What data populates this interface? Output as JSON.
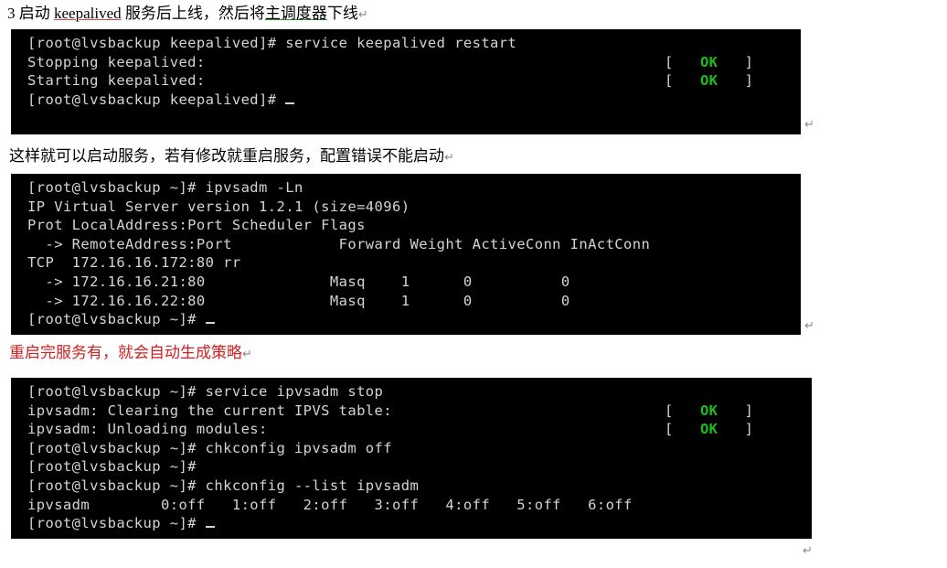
{
  "document": {
    "paragraph_1": {
      "number": "3",
      "text_before": " 启动 ",
      "spell_word": "keepalived",
      "text_mid": " 服务后上线，然后将",
      "grammar_word": "主调度器",
      "text_after": "下线",
      "pilcrow": "↵"
    },
    "paragraph_2": {
      "text": "这样就可以启动服务，若有修改就重启服务，配置错误不能启动",
      "pilcrow": "↵"
    },
    "paragraph_3": {
      "text": "重启完服务有，就会自动生成策略",
      "pilcrow": "↵",
      "color": "#d02020"
    }
  },
  "terminals": [
    {
      "name": "keepalived-restart-terminal",
      "pilcrow": "↵",
      "lines": [
        {
          "text": "[root@lvsbackup keepalived]# service keepalived restart",
          "status": null
        },
        {
          "text": "Stopping keepalived:",
          "status": {
            "open": "[",
            "label": "OK",
            "close": "]"
          }
        },
        {
          "text": "Starting keepalived:",
          "status": {
            "open": "[",
            "label": "OK",
            "close": "]"
          }
        },
        {
          "text": "[root@lvsbackup keepalived]# ",
          "status": null,
          "cursor": true
        }
      ]
    },
    {
      "name": "ipvsadm-list-terminal",
      "pilcrow": "↵",
      "lines": [
        {
          "text": "[root@lvsbackup ~]# ipvsadm -Ln",
          "status": null
        },
        {
          "text": "IP Virtual Server version 1.2.1 (size=4096)",
          "status": null
        },
        {
          "text": "Prot LocalAddress:Port Scheduler Flags",
          "status": null
        },
        {
          "text": "  -> RemoteAddress:Port            Forward Weight ActiveConn InActConn",
          "status": null
        },
        {
          "text": "TCP  172.16.16.172:80 rr",
          "status": null
        },
        {
          "text": "  -> 172.16.16.21:80              Masq    1      0          0",
          "status": null
        },
        {
          "text": "  -> 172.16.16.22:80              Masq    1      0          0",
          "status": null
        },
        {
          "text": "[root@lvsbackup ~]# ",
          "status": null,
          "cursor": true
        }
      ]
    },
    {
      "name": "ipvsadm-stop-chkconfig-terminal",
      "pilcrow": "↵",
      "lines": [
        {
          "text": "[root@lvsbackup ~]# service ipvsadm stop",
          "status": null
        },
        {
          "text": "ipvsadm: Clearing the current IPVS table:",
          "status": {
            "open": "[",
            "label": "OK",
            "close": "]"
          }
        },
        {
          "text": "ipvsadm: Unloading modules:",
          "status": {
            "open": "[",
            "label": "OK",
            "close": "]"
          }
        },
        {
          "text": "[root@lvsbackup ~]# chkconfig ipvsadm off",
          "status": null
        },
        {
          "text": "[root@lvsbackup ~]#",
          "status": null
        },
        {
          "text": "[root@lvsbackup ~]# chkconfig --list ipvsadm",
          "status": null
        },
        {
          "text": "ipvsadm        0:off   1:off   2:off   3:off   4:off   5:off   6:off",
          "status": null
        },
        {
          "text": "[root@lvsbackup ~]# ",
          "status": null,
          "cursor": true
        }
      ]
    }
  ],
  "colors": {
    "terminal_bg": "#000000",
    "terminal_fg": "#d4d4d4",
    "status_ok": "#18c018",
    "red_text": "#d02020",
    "spell_underline": "#c94a4a",
    "grammar_underline": "#2e8b3d"
  }
}
